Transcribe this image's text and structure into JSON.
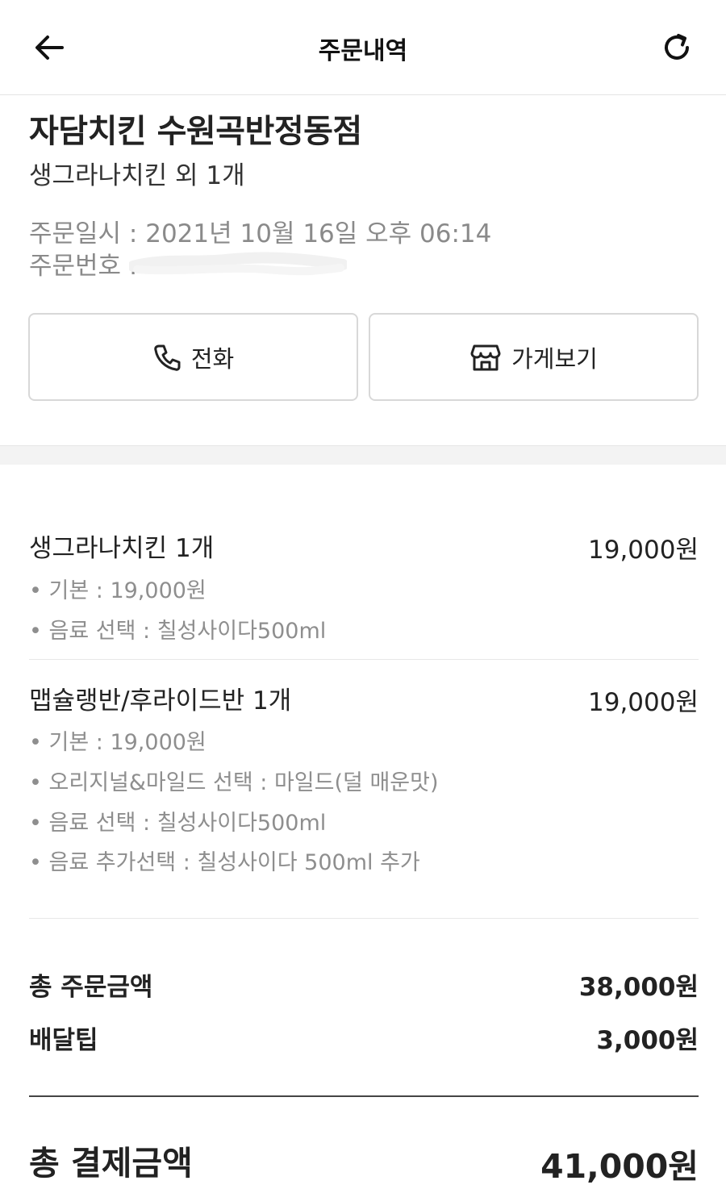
{
  "header": {
    "title": "주문내역",
    "back_icon": "arrow-left-icon",
    "refresh_icon": "refresh-icon"
  },
  "order": {
    "store_name": "자담치킨 수원곡반정동점",
    "summary": "생그라나치킨 외 1개",
    "date_line": "주문일시 : 2021년 10월 16일 오후 06:14",
    "number_label": "주문번호 :"
  },
  "actions": {
    "call_label": "전화",
    "store_label": "가게보기"
  },
  "items": [
    {
      "name": "생그라나치킨 1개",
      "price": "19,000원",
      "options": [
        "• 기본 : 19,000원",
        "• 음료 선택 : 칠성사이다500ml"
      ]
    },
    {
      "name": "맵슐랭반/후라이드반 1개",
      "price": "19,000원",
      "options": [
        "• 기본 : 19,000원",
        "• 오리지널&마일드 선택 : 마일드(덜 매운맛)",
        "• 음료 선택 : 칠성사이다500ml",
        "• 음료 추가선택 : 칠성사이다 500ml 추가"
      ]
    }
  ],
  "totals": {
    "order_amount_label": "총 주문금액",
    "order_amount": "38,000원",
    "delivery_tip_label": "배달팁",
    "delivery_tip": "3,000원",
    "payment_label": "총 결제금액",
    "payment": "41,000원"
  }
}
